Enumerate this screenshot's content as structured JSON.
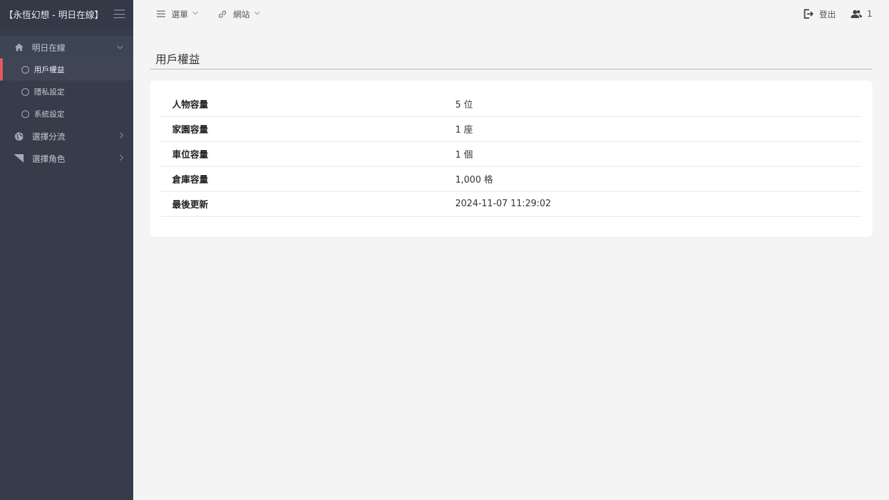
{
  "sidebar": {
    "brand": "【永恆幻想 - 明日在線】",
    "groups": [
      {
        "label": "明日在線",
        "icon": "home-icon",
        "items": [
          {
            "label": "用戶權益"
          },
          {
            "label": "隱私設定"
          },
          {
            "label": "系統設定"
          }
        ]
      },
      {
        "label": "選擇分流",
        "icon": "globe-icon"
      },
      {
        "label": "選擇角色",
        "icon": "flag-icon"
      }
    ]
  },
  "topbar": {
    "menu_label": "選單",
    "site_label": "網站",
    "logout_label": "登出",
    "users_count": "1"
  },
  "page": {
    "title": "用戶權益"
  },
  "rights": [
    {
      "key": "人物容量",
      "value": "5 位"
    },
    {
      "key": "家園容量",
      "value": "1 座"
    },
    {
      "key": "車位容量",
      "value": "1 個"
    },
    {
      "key": "倉庫容量",
      "value": "1,000 格"
    },
    {
      "key": "最後更新",
      "value": "2024-11-07 11:29:02"
    }
  ],
  "colors": {
    "sidebar_bg": "#363c4a",
    "active_accent": "#e55a5a",
    "page_bg": "#f4f4f4"
  }
}
